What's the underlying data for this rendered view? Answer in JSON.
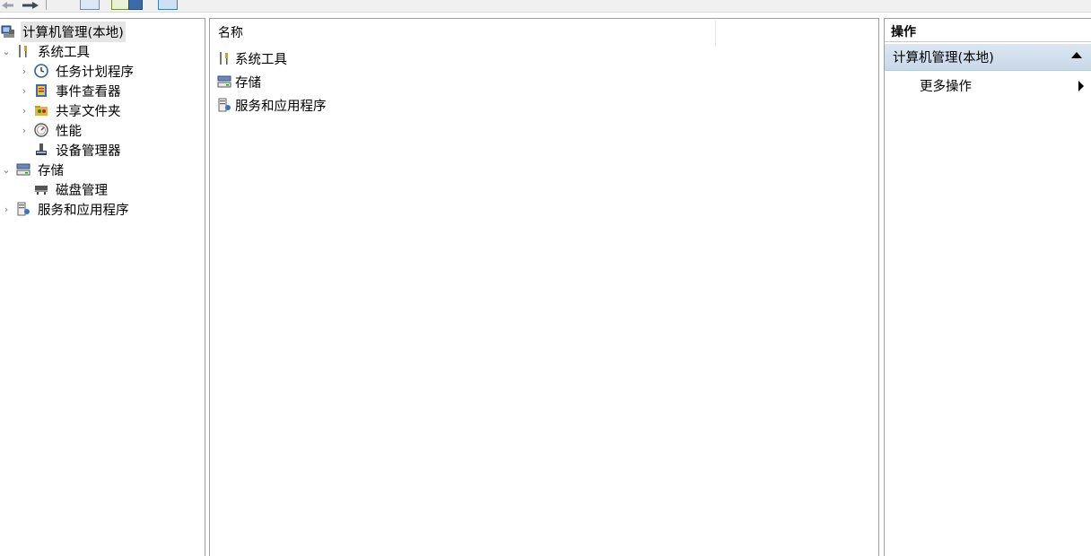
{
  "tree": {
    "root": {
      "label": "计算机管理(本地)",
      "icon": "computer-management-icon"
    },
    "items": [
      {
        "label": "系统工具",
        "icon": "system-tools-icon",
        "expanded": true
      },
      {
        "label": "任务计划程序",
        "icon": "task-scheduler-icon"
      },
      {
        "label": "事件查看器",
        "icon": "event-viewer-icon"
      },
      {
        "label": "共享文件夹",
        "icon": "shared-folders-icon"
      },
      {
        "label": "性能",
        "icon": "performance-icon"
      },
      {
        "label": "设备管理器",
        "icon": "device-manager-icon"
      },
      {
        "label": "存储",
        "icon": "storage-icon",
        "expanded": true
      },
      {
        "label": "磁盘管理",
        "icon": "disk-management-icon"
      },
      {
        "label": "服务和应用程序",
        "icon": "services-applications-icon"
      }
    ]
  },
  "list": {
    "column_name": "名称",
    "rows": [
      {
        "label": "系统工具",
        "icon": "system-tools-icon"
      },
      {
        "label": "存储",
        "icon": "storage-icon"
      },
      {
        "label": "服务和应用程序",
        "icon": "services-applications-icon"
      }
    ]
  },
  "actions": {
    "title": "操作",
    "section": "计算机管理(本地)",
    "more": "更多操作"
  },
  "colors": {
    "selection": "#e5e5e5",
    "action_header": "#c9d9ea"
  }
}
